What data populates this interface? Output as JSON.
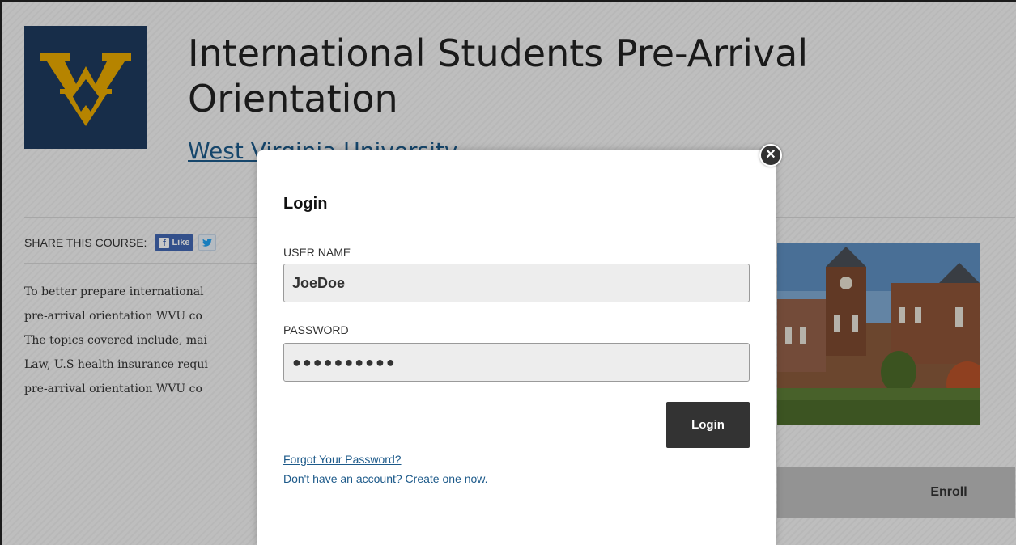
{
  "course": {
    "title": "International Students Pre-Arrival Orientation",
    "university": "West Virginia University"
  },
  "share": {
    "label": "SHARE THIS COURSE:",
    "facebook_label": "Like"
  },
  "description_lines": [
    "To better prepare international",
    "pre-arrival orientation WVU co",
    "The topics covered include, mai",
    "Law, U.S health insurance requi",
    "pre-arrival orientation WVU co"
  ],
  "enroll_label": "Enroll",
  "login_modal": {
    "title": "Login",
    "username_label": "USER NAME",
    "username_value": "JoeDoe",
    "password_label": "PASSWORD",
    "password_value": "●●●●●●●●●●",
    "login_button": "Login",
    "forgot_password_link": "Forgot Your Password?",
    "create_account_link": "Don't have an account? Create one now."
  },
  "colors": {
    "logo_bg": "#1e3a5e",
    "logo_gold": "#eaaa00",
    "link": "#1d5a8a",
    "button_dark": "#333333"
  }
}
